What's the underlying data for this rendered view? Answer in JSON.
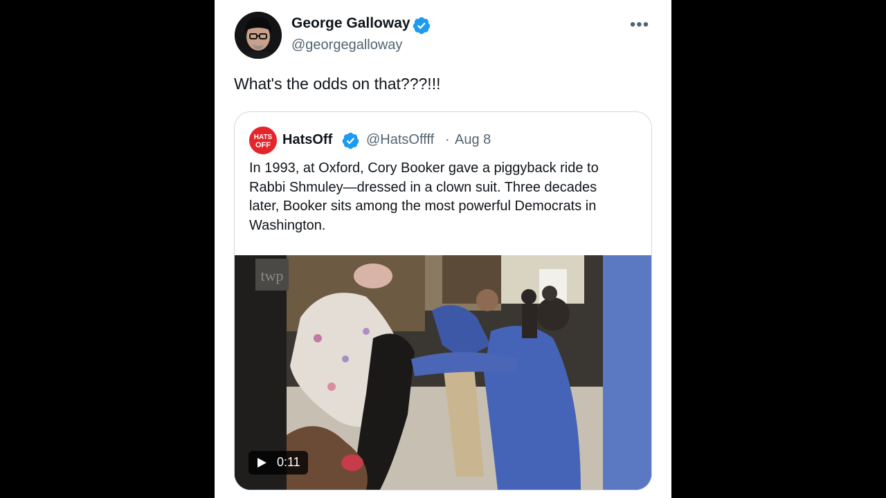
{
  "tweet": {
    "author_name": "George Galloway",
    "author_handle": "@georgegalloway",
    "text": "What's the odds on that???!!!",
    "more_icon": "more-horizontal-icon",
    "verified_icon": "verified-badge-icon",
    "more_label": "•••"
  },
  "quoted_tweet": {
    "author_name": "HatsOff",
    "author_handle": "@HatsOffff",
    "separator": "·",
    "date": "Aug 8",
    "avatar_text_line1": "HATS",
    "avatar_text_line2": "OFF",
    "lines": [
      "In 1993, at Oxford, Cory Booker gave a piggyback ride to",
      "Rabbi Shmuley—dressed in a clown suit. Three decades",
      "later, Booker sits among the most powerful Democrats in",
      "Washington."
    ],
    "video": {
      "duration": "0:11",
      "play_icon": "play-icon",
      "watermark": "twp"
    }
  },
  "colors": {
    "verified_blue": "#1d9bf0",
    "text_primary": "#0f1419",
    "text_secondary": "#536471",
    "border": "#cfd9de",
    "hatsoff_red": "#e4262b"
  }
}
